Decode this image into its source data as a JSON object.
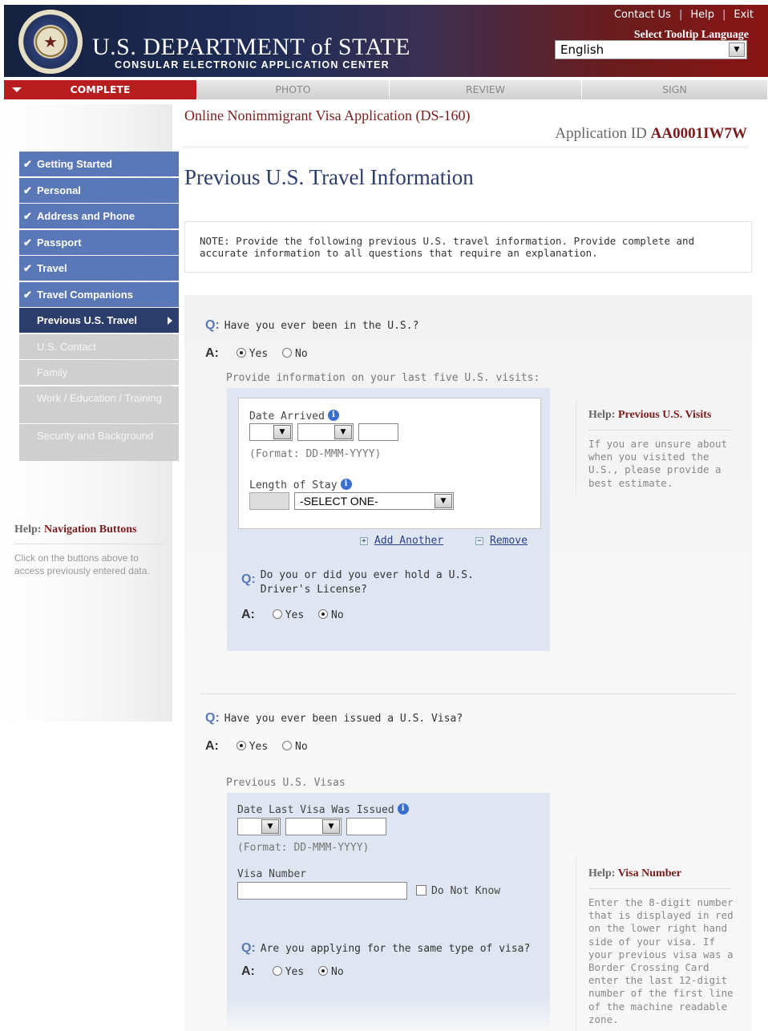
{
  "header": {
    "links": [
      "Contact Us",
      "Help",
      "Exit"
    ],
    "dept_title": "U.S. DEPARTMENT of STATE",
    "dept_subtitle": "CONSULAR ELECTRONIC APPLICATION CENTER",
    "tooltip_language_label": "Select Tooltip Language",
    "language_value": "English"
  },
  "progress_tabs": [
    {
      "label": "COMPLETE",
      "active": true
    },
    {
      "label": "PHOTO",
      "active": false
    },
    {
      "label": "REVIEW",
      "active": false
    },
    {
      "label": "SIGN",
      "active": false
    }
  ],
  "application": {
    "title": "Online Nonimmigrant Visa Application (DS-160)",
    "id_label": "Application ID",
    "id_value": "AA0001IW7W"
  },
  "sidebar": {
    "items": [
      {
        "label": "Getting Started",
        "state": "done"
      },
      {
        "label": "Personal",
        "state": "done"
      },
      {
        "label": "Address and Phone",
        "state": "done"
      },
      {
        "label": "Passport",
        "state": "done"
      },
      {
        "label": "Travel",
        "state": "done"
      },
      {
        "label": "Travel Companions",
        "state": "done"
      },
      {
        "label": "Previous U.S. Travel",
        "state": "current"
      },
      {
        "label": "U.S. Contact",
        "state": "future"
      },
      {
        "label": "Family",
        "state": "future"
      },
      {
        "label": "Work / Education / Training",
        "state": "future"
      },
      {
        "label": "Security and Background",
        "state": "future"
      }
    ],
    "help": {
      "prefix": "Help:",
      "title": "Navigation Buttons",
      "text": "Click on the buttons above to access previously entered data."
    }
  },
  "page": {
    "title": "Previous U.S. Travel Information",
    "note": "NOTE: Provide the following previous U.S. travel information. Provide complete and accurate information to all questions that require an explanation."
  },
  "section1": {
    "q_label": "Q:",
    "a_label": "A:",
    "question": "Have you ever been in the U.S.?",
    "yes": "Yes",
    "no": "No",
    "answer": "Yes",
    "instruction": "Provide information on your last five U.S. visits:",
    "date_arrived_label": "Date Arrived",
    "date_format": "(Format: DD-MMM-YYYY)",
    "length_of_stay_label": "Length of Stay",
    "length_select": "-SELECT ONE-",
    "add_another": "Add Another",
    "remove": "Remove",
    "dl_question": "Do you or did you ever hold a U.S. Driver's License?",
    "dl_answer": "No"
  },
  "help1": {
    "prefix": "Help:",
    "title": "Previous U.S. Visits",
    "text": "If you are unsure about when you visited the U.S., please provide a best estimate."
  },
  "section2": {
    "question": "Have you ever been issued a U.S. Visa?",
    "answer": "Yes",
    "sub_label": "Previous U.S. Visas",
    "date_last_label": "Date Last Visa Was Issued",
    "date_format": "(Format: DD-MMM-YYYY)",
    "visa_number_label": "Visa Number",
    "do_not_know": "Do Not Know",
    "same_type_question": "Are you applying for the same type of visa?",
    "same_type_answer": "No"
  },
  "help2": {
    "prefix": "Help:",
    "title": "Visa Number",
    "text": "Enter the 8-digit number that is displayed in red on the lower right hand side of your visa. If your previous visa was a Border Crossing Card enter the last 12-digit number of the first line of the machine readable zone."
  }
}
